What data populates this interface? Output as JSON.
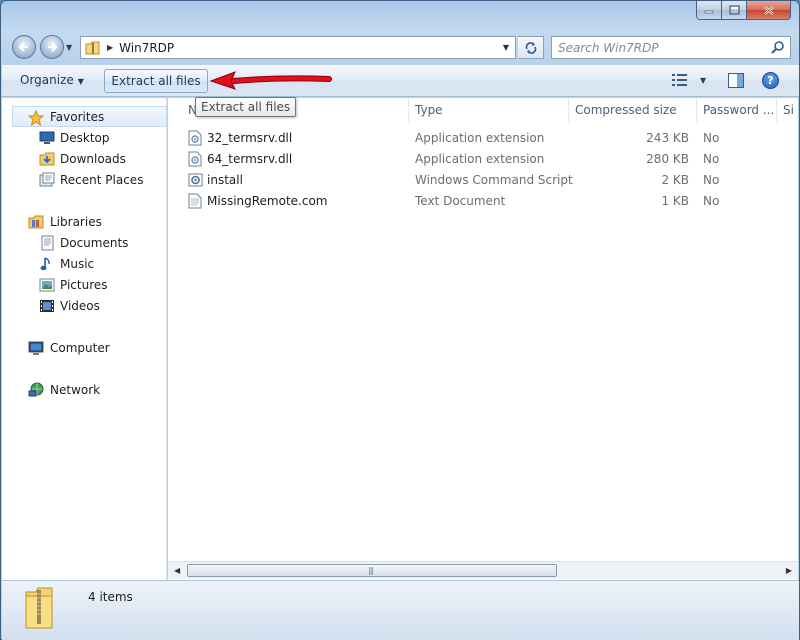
{
  "window": {
    "title": "",
    "buttons": [
      "minimize",
      "maximize",
      "close"
    ]
  },
  "address": {
    "path": "Win7RDP",
    "search_placeholder": "Search Win7RDP"
  },
  "toolbar": {
    "organize_label": "Organize",
    "extract_label": "Extract all files",
    "tooltip": "Extract all files",
    "help_label": "?"
  },
  "nav": {
    "favorites": {
      "label": "Favorites",
      "items": [
        {
          "label": "Desktop",
          "icon": "desktop-icon"
        },
        {
          "label": "Downloads",
          "icon": "downloads-icon"
        },
        {
          "label": "Recent Places",
          "icon": "recent-places-icon"
        }
      ]
    },
    "libraries": {
      "label": "Libraries",
      "items": [
        {
          "label": "Documents",
          "icon": "documents-icon"
        },
        {
          "label": "Music",
          "icon": "music-icon"
        },
        {
          "label": "Pictures",
          "icon": "pictures-icon"
        },
        {
          "label": "Videos",
          "icon": "videos-icon"
        }
      ]
    },
    "computer": {
      "label": "Computer"
    },
    "network": {
      "label": "Network"
    }
  },
  "columns": {
    "name": "N",
    "type": "Type",
    "compressed_size": "Compressed size",
    "password": "Password ...",
    "extra": "Si"
  },
  "files": [
    {
      "name": "32_termsrv.dll",
      "type": "Application extension",
      "size": "243 KB",
      "password": "No",
      "icon": "dll-icon"
    },
    {
      "name": "64_termsrv.dll",
      "type": "Application extension",
      "size": "280 KB",
      "password": "No",
      "icon": "dll-icon"
    },
    {
      "name": "install",
      "type": "Windows Command Script",
      "size": "2 KB",
      "password": "No",
      "icon": "script-icon"
    },
    {
      "name": "MissingRemote.com",
      "type": "Text Document",
      "size": "1 KB",
      "password": "No",
      "icon": "text-icon"
    }
  ],
  "status": {
    "count": "4 items"
  },
  "colors": {
    "arrow": "#d4000f",
    "accent": "#1e395b"
  }
}
